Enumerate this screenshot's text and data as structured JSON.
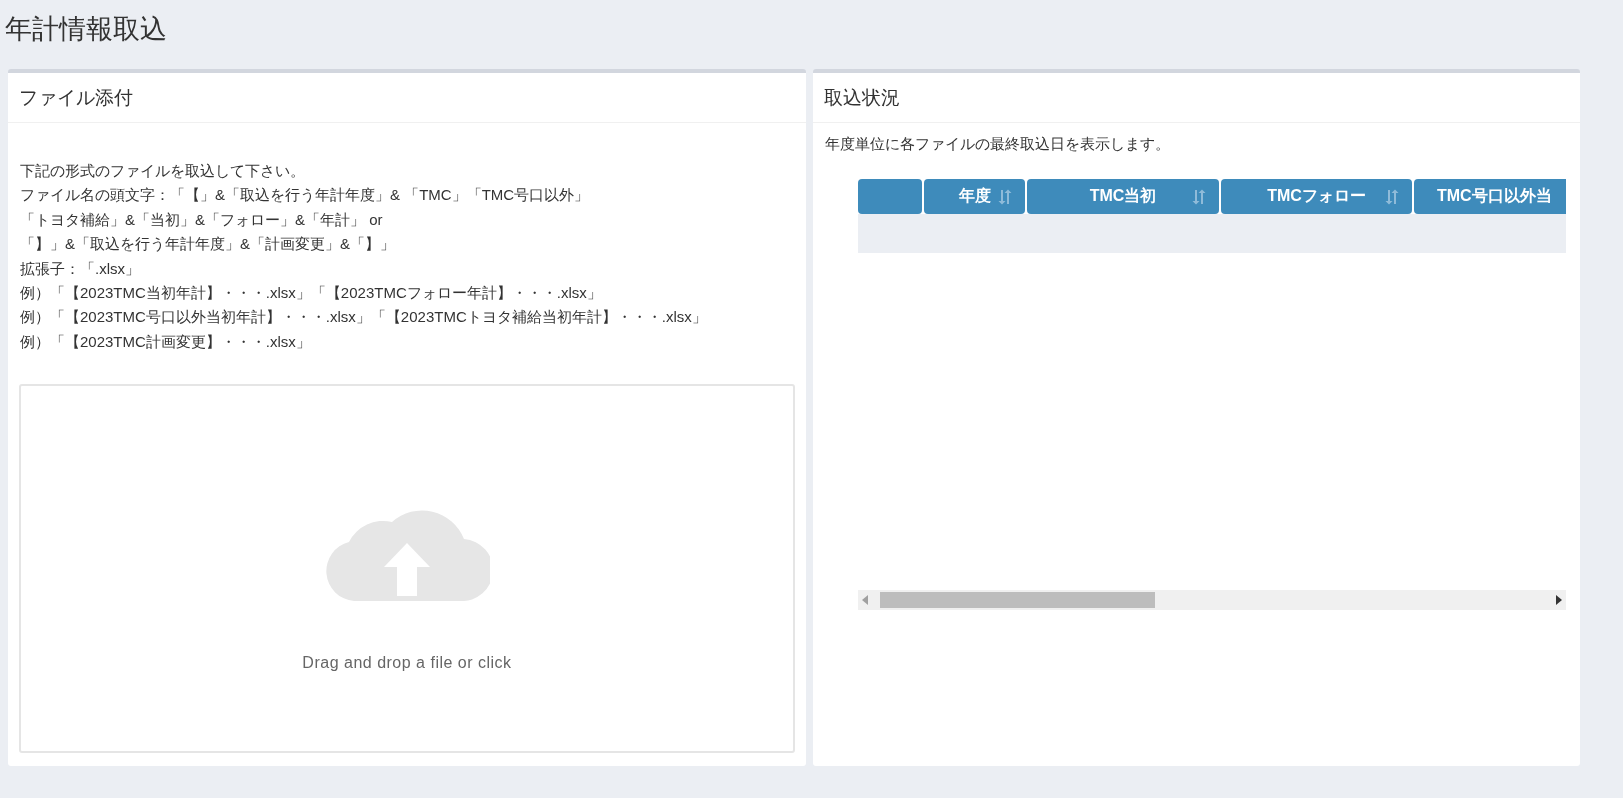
{
  "page_title": "年計情報取込",
  "upload_panel": {
    "title": "ファイル添付",
    "instructions": [
      "下記の形式のファイルを取込して下さい。",
      "ファイル名の頭文字：「【」&「取込を行う年計年度」& 「TMC」「TMC号口以外」",
      "「トヨタ補給」&「当初」&「フォロー」&「年計」 or",
      "「】」&「取込を行う年計年度」&「計画変更」&「】」",
      "拡張子：「.xlsx」",
      "例）「【2023TMC当初年計】・・・.xlsx」「【2023TMCフォロー年計】・・・.xlsx」",
      "例）「【2023TMC号口以外当初年計】・・・.xlsx」「【2023TMCトヨタ補給当初年計】・・・.xlsx」",
      "例）「【2023TMC計画変更】・・・.xlsx」"
    ],
    "dropzone_text": "Drag and drop a file or click"
  },
  "status_panel": {
    "title": "取込状況",
    "description": "年度単位に各ファイルの最終取込日を表示します。",
    "table": {
      "columns": [
        {
          "sortable": false
        },
        {
          "label": "年度",
          "sortable": true
        },
        {
          "label": "TMC当初",
          "sortable": true
        },
        {
          "label": "TMCフォロー",
          "sortable": true
        },
        {
          "label": "TMC号口以外当"
        }
      ]
    }
  }
}
